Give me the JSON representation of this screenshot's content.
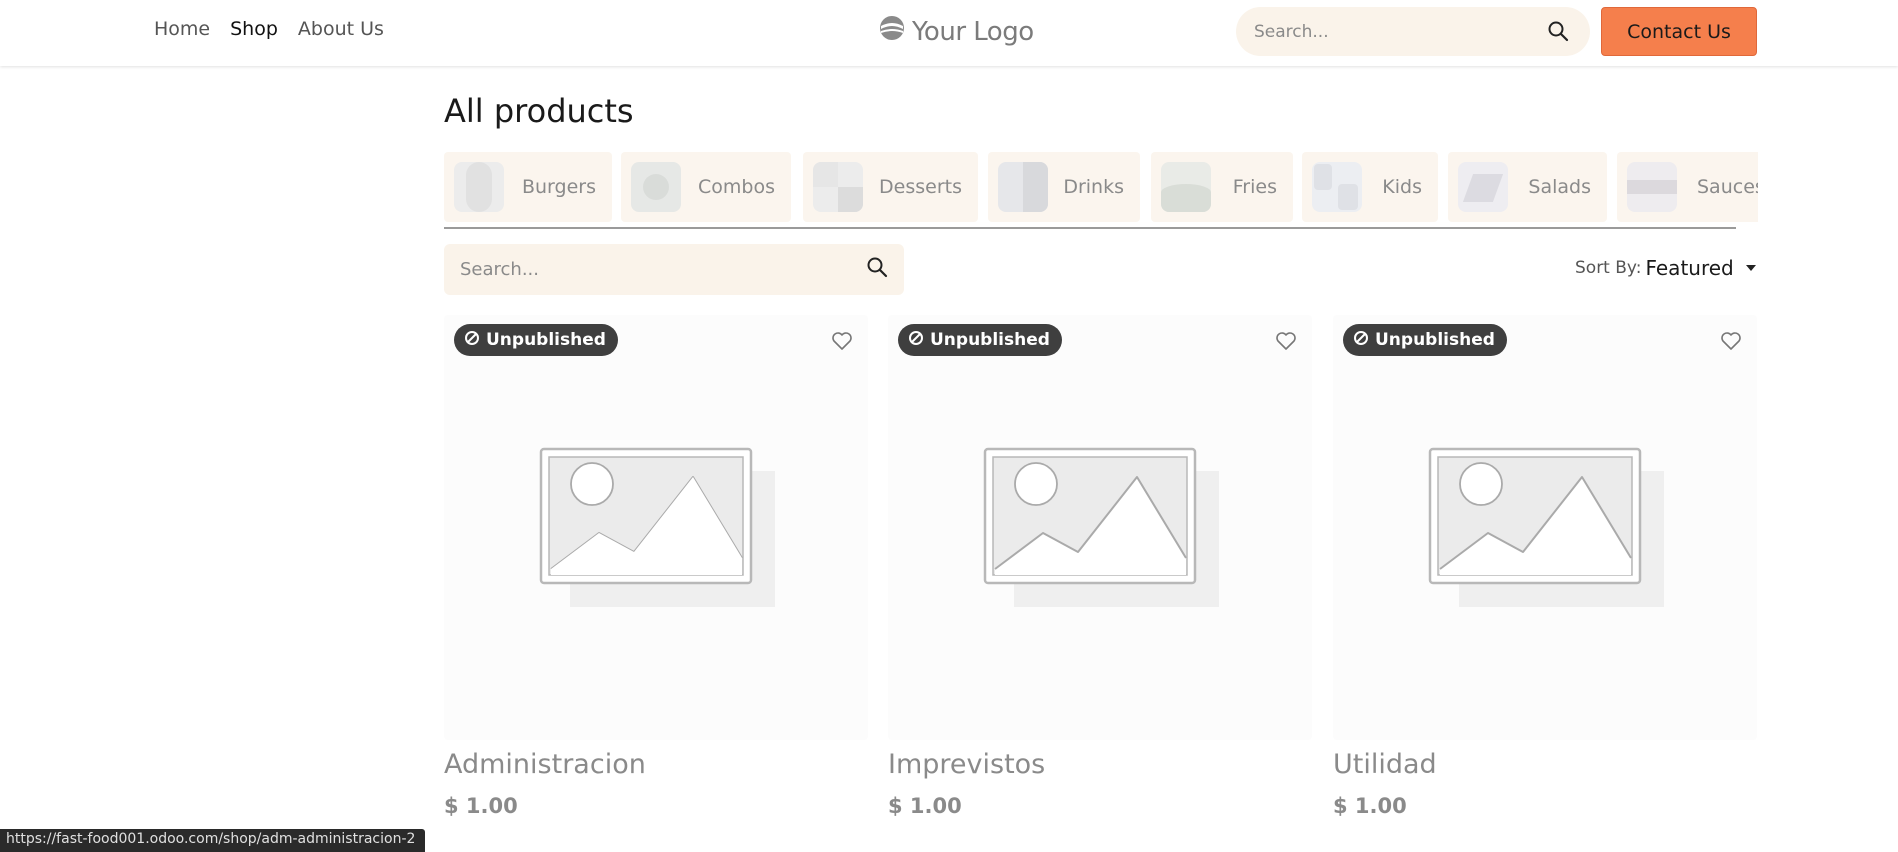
{
  "header": {
    "nav": [
      {
        "label": "Home"
      },
      {
        "label": "Shop"
      },
      {
        "label": "About Us"
      }
    ],
    "logo_text": "Your Logo",
    "search_placeholder": "Search...",
    "contact_label": "Contact Us",
    "accent_color": "#f57f4c"
  },
  "main": {
    "title": "All products",
    "categories": [
      {
        "label": "Burgers"
      },
      {
        "label": "Combos"
      },
      {
        "label": "Desserts"
      },
      {
        "label": "Drinks"
      },
      {
        "label": "Fries"
      },
      {
        "label": "Kids"
      },
      {
        "label": "Salads"
      },
      {
        "label": "Sauces"
      }
    ],
    "search_placeholder": "Search...",
    "sort_label": "Sort By:",
    "sort_value": "Featured",
    "products": [
      {
        "badge": "Unpublished",
        "name": "Administracion",
        "price": "$ 1.00"
      },
      {
        "badge": "Unpublished",
        "name": "Imprevistos",
        "price": "$ 1.00"
      },
      {
        "badge": "Unpublished",
        "name": "Utilidad",
        "price": "$ 1.00"
      }
    ]
  },
  "status_bar": {
    "url": "https://fast-food001.odoo.com/shop/adm-administracion-2"
  }
}
